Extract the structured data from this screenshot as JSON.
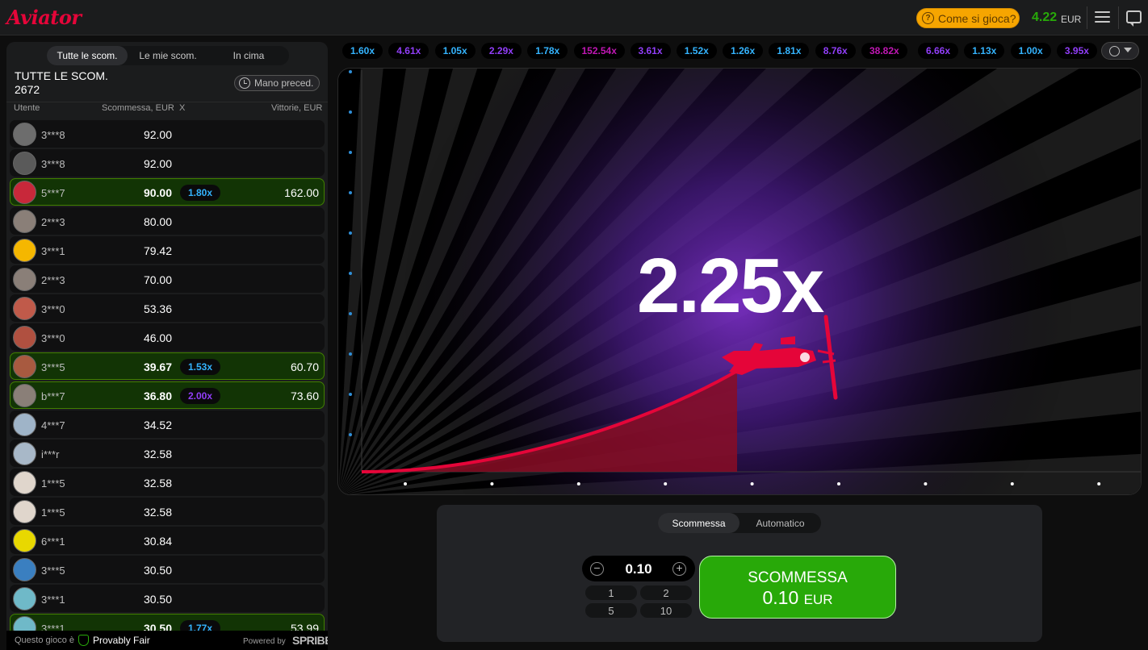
{
  "header": {
    "logo": "Aviator",
    "how_to_play": "Come si gioca?",
    "balance": "4.22",
    "currency": "EUR"
  },
  "bets_panel": {
    "tabs": [
      "Tutte le scom.",
      "Le mie scom.",
      "In cima"
    ],
    "active_tab": 0,
    "title": "TUTTE LE SCOM.",
    "count": "2672",
    "prev_hand": "Mano preced.",
    "columns": {
      "user": "Utente",
      "bet": "Scommessa, EUR",
      "x": "X",
      "win": "Vittorie, EUR"
    },
    "rows": [
      {
        "user": "3***8",
        "bet": "92.00",
        "mult": "",
        "win": "",
        "avatar": "#6d6d6d",
        "mult_color": ""
      },
      {
        "user": "3***8",
        "bet": "92.00",
        "mult": "",
        "win": "",
        "avatar": "#5a5a5a",
        "mult_color": ""
      },
      {
        "user": "5***7",
        "bet": "90.00",
        "mult": "1.80x",
        "win": "162.00",
        "avatar": "#c8283a",
        "mult_color": "#34b4ff"
      },
      {
        "user": "2***3",
        "bet": "80.00",
        "mult": "",
        "win": "",
        "avatar": "#8a7f78",
        "mult_color": ""
      },
      {
        "user": "3***1",
        "bet": "79.42",
        "mult": "",
        "win": "",
        "avatar": "#f5b700",
        "mult_color": ""
      },
      {
        "user": "2***3",
        "bet": "70.00",
        "mult": "",
        "win": "",
        "avatar": "#8a7f78",
        "mult_color": ""
      },
      {
        "user": "3***0",
        "bet": "53.36",
        "mult": "",
        "win": "",
        "avatar": "#c05a4a",
        "mult_color": ""
      },
      {
        "user": "3***0",
        "bet": "46.00",
        "mult": "",
        "win": "",
        "avatar": "#b05040",
        "mult_color": ""
      },
      {
        "user": "3***5",
        "bet": "39.67",
        "mult": "1.53x",
        "win": "60.70",
        "avatar": "#a85a40",
        "mult_color": "#34b4ff"
      },
      {
        "user": "b***7",
        "bet": "36.80",
        "mult": "2.00x",
        "win": "73.60",
        "avatar": "#8a7f78",
        "mult_color": "#913ef8"
      },
      {
        "user": "4***7",
        "bet": "34.52",
        "mult": "",
        "win": "",
        "avatar": "#9fb4c8",
        "mult_color": ""
      },
      {
        "user": "i***r",
        "bet": "32.58",
        "mult": "",
        "win": "",
        "avatar": "#a8b8c8",
        "mult_color": ""
      },
      {
        "user": "1***5",
        "bet": "32.58",
        "mult": "",
        "win": "",
        "avatar": "#e0d6cc",
        "mult_color": ""
      },
      {
        "user": "1***5",
        "bet": "32.58",
        "mult": "",
        "win": "",
        "avatar": "#e0d6cc",
        "mult_color": ""
      },
      {
        "user": "6***1",
        "bet": "30.84",
        "mult": "",
        "win": "",
        "avatar": "#e8d800",
        "mult_color": ""
      },
      {
        "user": "3***5",
        "bet": "30.50",
        "mult": "",
        "win": "",
        "avatar": "#3a7fc0",
        "mult_color": ""
      },
      {
        "user": "3***1",
        "bet": "30.50",
        "mult": "",
        "win": "",
        "avatar": "#6fb9c8",
        "mult_color": ""
      },
      {
        "user": "3***1",
        "bet": "30.50",
        "mult": "1.77x",
        "win": "53.99",
        "avatar": "#6fb9c8",
        "mult_color": "#34b4ff"
      }
    ],
    "footer": {
      "prefix": "Questo gioco è",
      "provably_fair": "Provably Fair",
      "powered_by": "Powered by",
      "brand": "SPRIBE"
    }
  },
  "history": [
    {
      "value": "1.60x",
      "color": "#34b4ff"
    },
    {
      "value": "4.61x",
      "color": "#913ef8"
    },
    {
      "value": "1.05x",
      "color": "#34b4ff"
    },
    {
      "value": "2.29x",
      "color": "#913ef8"
    },
    {
      "value": "1.78x",
      "color": "#34b4ff"
    },
    {
      "value": "152.54x",
      "color": "#c017b4"
    },
    {
      "value": "3.61x",
      "color": "#913ef8"
    },
    {
      "value": "1.52x",
      "color": "#34b4ff"
    },
    {
      "value": "1.26x",
      "color": "#34b4ff"
    },
    {
      "value": "1.81x",
      "color": "#34b4ff"
    },
    {
      "value": "8.76x",
      "color": "#913ef8"
    },
    {
      "value": "38.82x",
      "color": "#c017b4"
    },
    {
      "value": "6.66x",
      "color": "#913ef8"
    },
    {
      "value": "1.13x",
      "color": "#34b4ff"
    },
    {
      "value": "1.00x",
      "color": "#34b4ff"
    },
    {
      "value": "3.95x",
      "color": "#913ef8"
    }
  ],
  "game": {
    "multiplier": "2.25x",
    "plane_icon": "plane-icon"
  },
  "bet_controls": {
    "tabs": [
      "Scommessa",
      "Automatico"
    ],
    "active_tab": 0,
    "amount": "0.10",
    "quick": [
      "1",
      "2",
      "5",
      "10"
    ],
    "button_label": "SCOMMESSA",
    "button_amount": "0.10",
    "button_currency": "EUR"
  }
}
